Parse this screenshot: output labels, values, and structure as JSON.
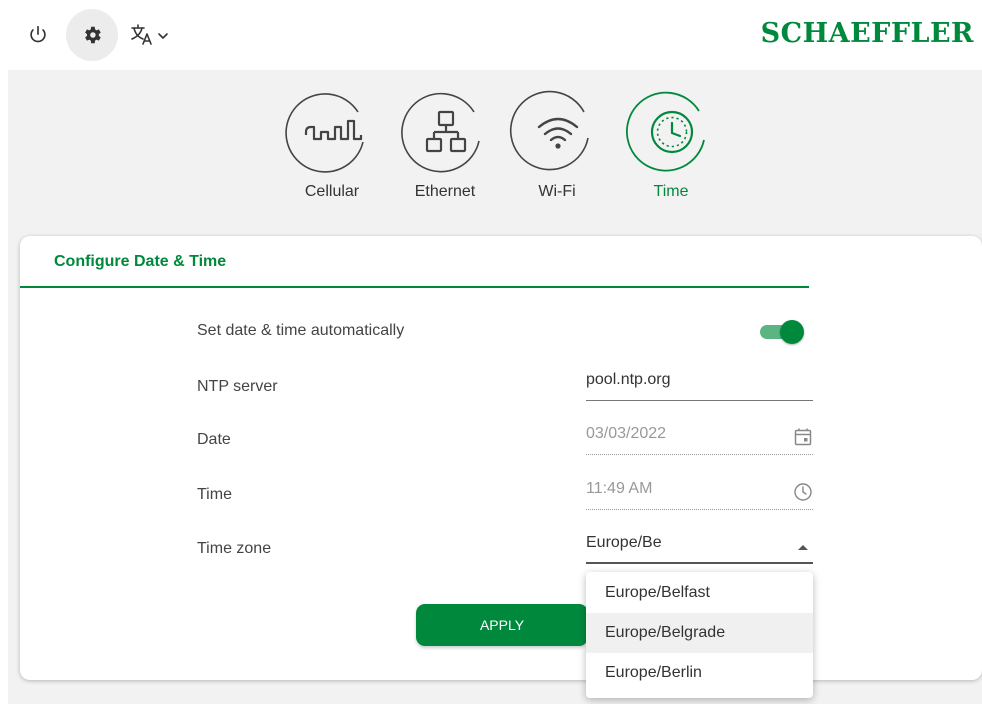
{
  "header": {
    "brand": "SCHAEFFLER",
    "power_icon": "power-icon",
    "settings_icon": "gear-icon",
    "language_icon": "translate-icon"
  },
  "tabs": [
    {
      "label": "Cellular",
      "icon": "cellular-icon",
      "active": false
    },
    {
      "label": "Ethernet",
      "icon": "ethernet-icon",
      "active": false
    },
    {
      "label": "Wi-Fi",
      "icon": "wifi-icon",
      "active": false
    },
    {
      "label": "Time",
      "icon": "clock-icon",
      "active": true
    }
  ],
  "card": {
    "title": "Configure Date & Time",
    "auto_label": "Set date & time automatically",
    "auto_enabled": true,
    "ntp_label": "NTP server",
    "ntp_value": "pool.ntp.org",
    "date_label": "Date",
    "date_value": "03/03/2022",
    "time_label": "Time",
    "time_value": "11:49 AM",
    "timezone_label": "Time zone",
    "timezone_value": "Europe/Be",
    "apply_label": "APPLY"
  },
  "timezone_options": [
    "Europe/Belfast",
    "Europe/Belgrade",
    "Europe/Berlin"
  ],
  "colors": {
    "accent": "#00893d",
    "accent_light": "#5cb483",
    "background": "#f2f2f2"
  }
}
